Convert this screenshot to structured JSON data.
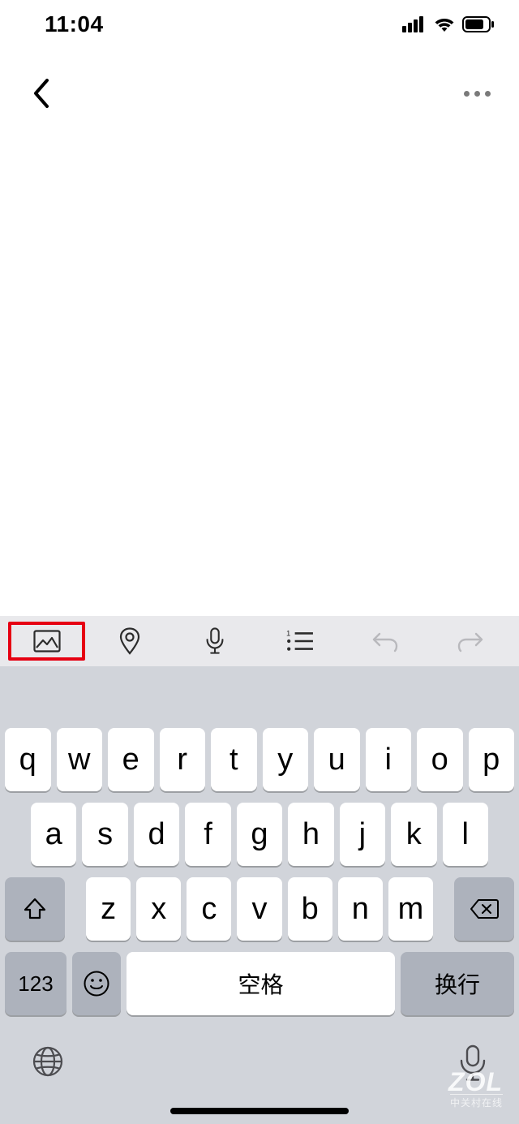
{
  "status": {
    "time": "11:04"
  },
  "toolbar": {
    "items": [
      {
        "name": "image-icon",
        "highlighted": true
      },
      {
        "name": "location-icon"
      },
      {
        "name": "microphone-icon"
      },
      {
        "name": "list-icon"
      },
      {
        "name": "undo-icon",
        "disabled": true
      },
      {
        "name": "redo-icon",
        "disabled": true
      }
    ]
  },
  "keyboard": {
    "row1": [
      "q",
      "w",
      "e",
      "r",
      "t",
      "y",
      "u",
      "i",
      "o",
      "p"
    ],
    "row2": [
      "a",
      "s",
      "d",
      "f",
      "g",
      "h",
      "j",
      "k",
      "l"
    ],
    "row3": [
      "z",
      "x",
      "c",
      "v",
      "b",
      "n",
      "m"
    ],
    "numKey": "123",
    "spaceLabel": "空格",
    "returnLabel": "换行"
  },
  "watermark": {
    "main": "ZOL",
    "sub": "中关村在线"
  }
}
